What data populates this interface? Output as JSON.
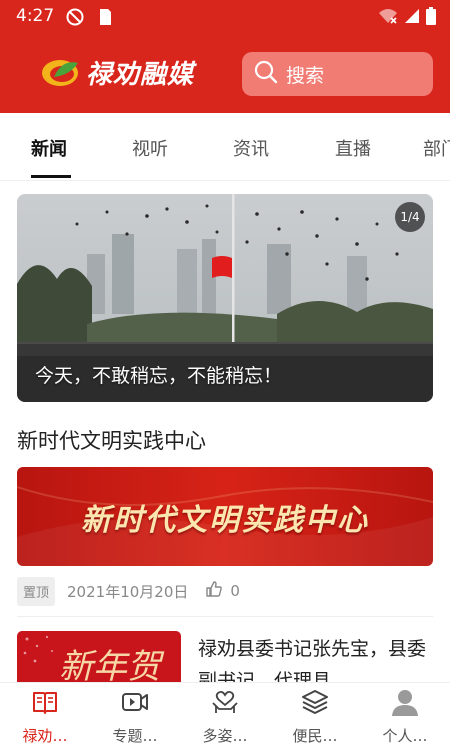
{
  "status_bar": {
    "time": "4:27",
    "icons": [
      "circle-slash-icon",
      "sim-card-icon",
      "wifi-off-icon",
      "signal-icon",
      "battery-icon"
    ]
  },
  "header": {
    "logo_text": "禄劝融媒",
    "search_placeholder": "搜索",
    "colors": {
      "brand": "#d9261c",
      "search_bg": "#f07c74"
    }
  },
  "tabs": [
    {
      "label": "新闻",
      "active": true
    },
    {
      "label": "视听",
      "active": false
    },
    {
      "label": "资讯",
      "active": false
    },
    {
      "label": "直播",
      "active": false
    },
    {
      "label": "部门",
      "active": false
    }
  ],
  "banner": {
    "caption": "今天，不敢稍忘，不能稍忘！",
    "counter": "1/4"
  },
  "section": {
    "title": "新时代文明实践中心",
    "card_text": "新时代文明实践中心",
    "pin_label": "置顶",
    "date": "2021年10月20日",
    "likes": "0"
  },
  "news_item": {
    "title": "禄劝县委书记张先宝，县委副书记、代理县",
    "thumb_text": "新年贺词"
  },
  "bottom_nav": [
    {
      "label": "禄劝…",
      "icon": "book-icon",
      "active": true
    },
    {
      "label": "专题…",
      "icon": "video-icon",
      "active": false
    },
    {
      "label": "多姿…",
      "icon": "hands-heart-icon",
      "active": false
    },
    {
      "label": "便民…",
      "icon": "layers-icon",
      "active": false
    },
    {
      "label": "个人…",
      "icon": "person-icon",
      "active": false
    }
  ]
}
